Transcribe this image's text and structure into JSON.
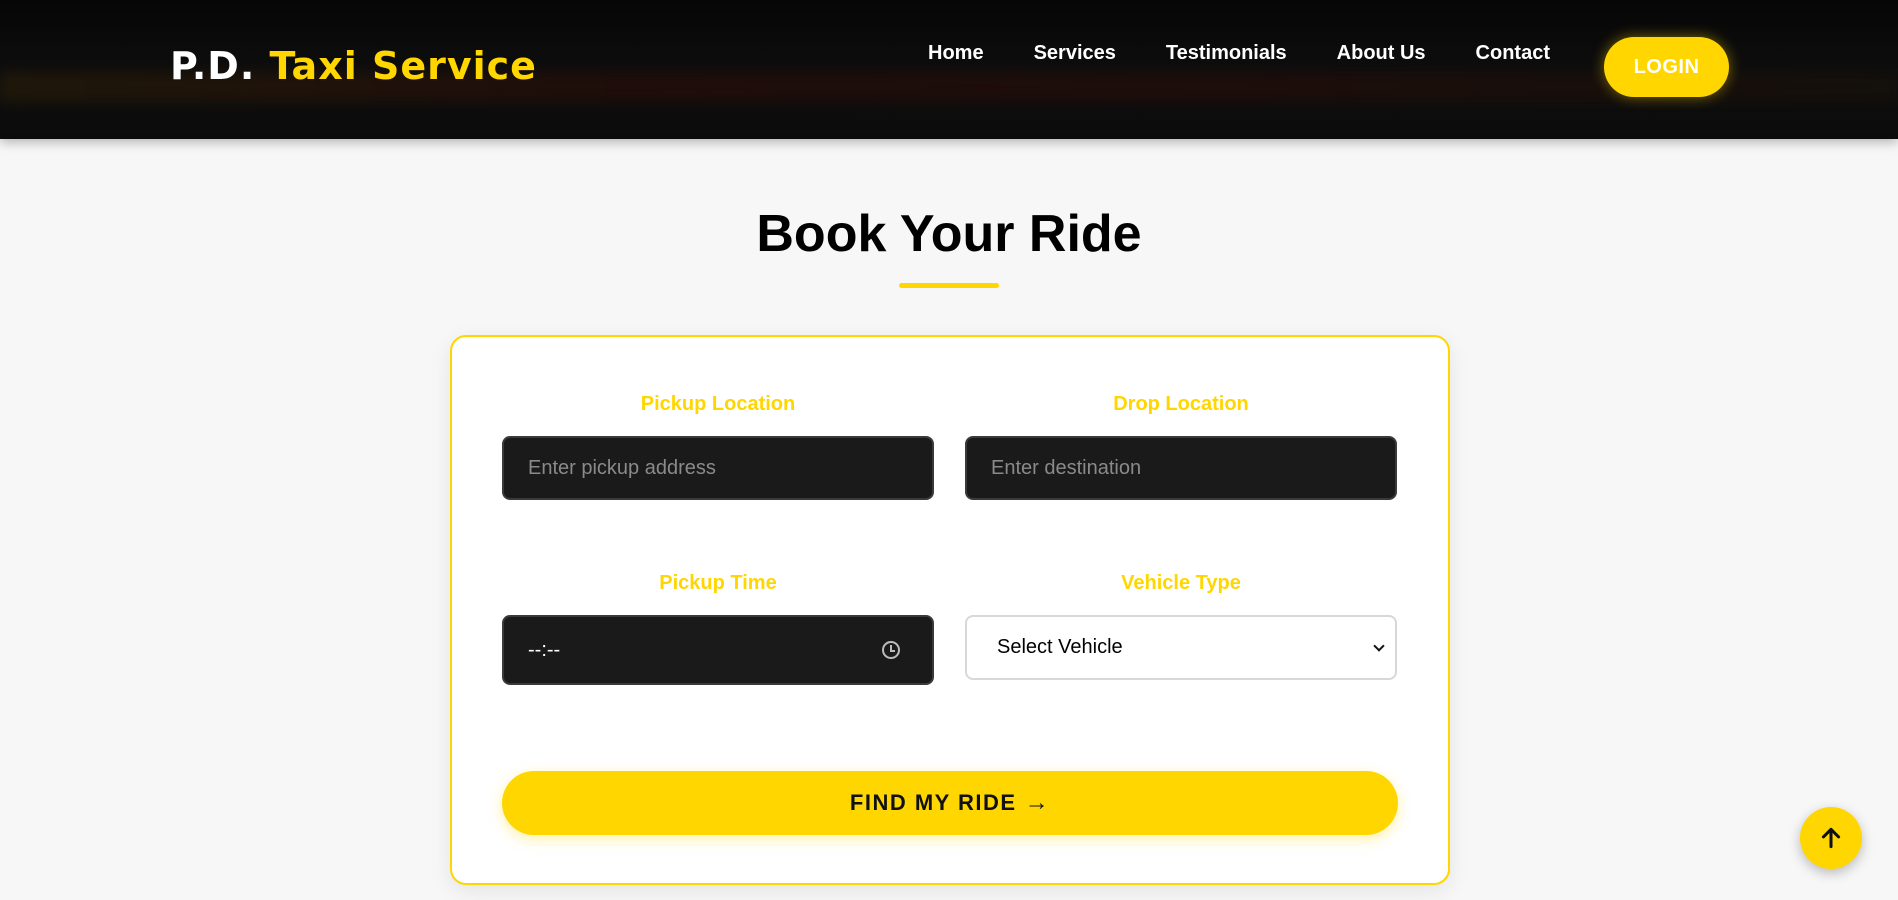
{
  "header": {
    "logo_primary": "P.D.",
    "logo_accent": "Taxi Service",
    "nav": [
      "Home",
      "Services",
      "Testimonials",
      "About Us",
      "Contact"
    ],
    "login_label": "LOGIN"
  },
  "main": {
    "title": "Book Your Ride",
    "form": {
      "pickup_label": "Pickup Location",
      "pickup_placeholder": "Enter pickup address",
      "drop_label": "Drop Location",
      "drop_placeholder": "Enter destination",
      "time_label": "Pickup Time",
      "time_value": "--:--",
      "vehicle_label": "Vehicle Type",
      "vehicle_value": "Select Vehicle",
      "submit_label": "FIND MY RIDE",
      "submit_arrow": "→"
    }
  },
  "icons": {
    "clock": "clock-icon",
    "chevron": "chevron-down-icon",
    "scroll_top": "arrow-up-icon"
  },
  "colors": {
    "accent": "#ffd600",
    "header_bg": "#0b0b0b",
    "input_bg": "#1a1a1a",
    "page_bg": "#f7f7f7"
  }
}
